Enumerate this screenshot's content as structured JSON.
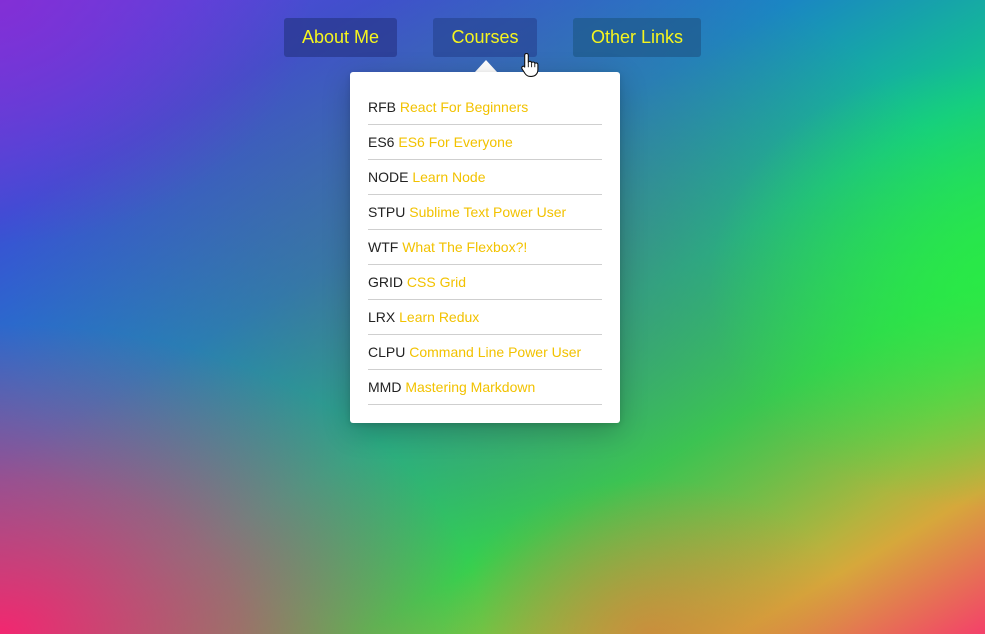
{
  "nav": {
    "about_label": "About Me",
    "courses_label": "Courses",
    "links_label": "Other Links"
  },
  "courses": [
    {
      "code": "RFB",
      "name": "React For Beginners"
    },
    {
      "code": "ES6",
      "name": "ES6 For Everyone"
    },
    {
      "code": "NODE",
      "name": "Learn Node"
    },
    {
      "code": "STPU",
      "name": "Sublime Text Power User"
    },
    {
      "code": "WTF",
      "name": "What The Flexbox?!"
    },
    {
      "code": "GRID",
      "name": "CSS Grid"
    },
    {
      "code": "LRX",
      "name": "Learn Redux"
    },
    {
      "code": "CLPU",
      "name": "Command Line Power User"
    },
    {
      "code": "MMD",
      "name": "Mastering Markdown"
    }
  ],
  "colors": {
    "nav_text": "#f5f51e",
    "course_link": "#f2c200",
    "course_code": "#222222",
    "dropdown_bg": "#ffffff"
  },
  "icons": {
    "cursor": "hand-pointer-icon"
  }
}
